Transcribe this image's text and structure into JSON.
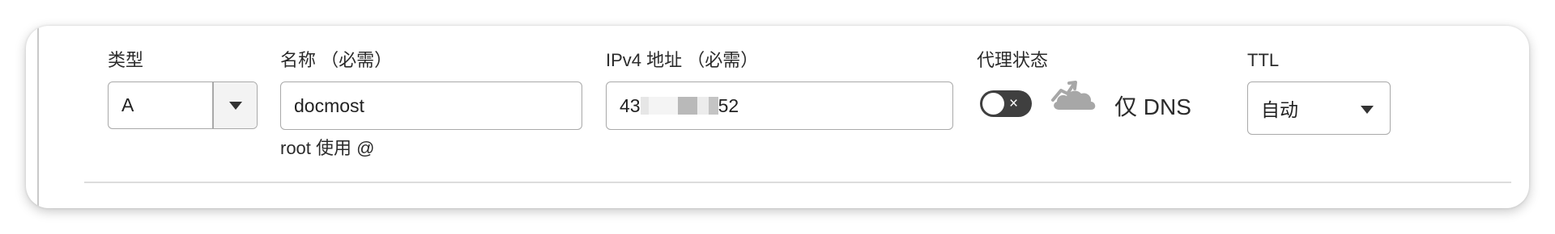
{
  "record": {
    "type_label": "类型",
    "type_value": "A",
    "name_label": "名称 （必需）",
    "name_value": "docmost",
    "name_hint": "root 使用 @",
    "ipv4_label": "IPv4 地址 （必需）",
    "ipv4_prefix": "43",
    "ipv4_suffix": "52",
    "proxy_label": "代理状态",
    "proxy_toggle_symbol": "×",
    "proxy_state_text": "仅 DNS",
    "ttl_label": "TTL",
    "ttl_value": "自动"
  },
  "icons": {
    "type_dropdown": "chevron-down-icon",
    "proxy_cloud": "cloud-icon",
    "ttl_dropdown": "chevron-down-icon"
  },
  "colors": {
    "toggle_off": "#3f3f3f",
    "cloud": "#a7a7a7",
    "border": "#a9a9a9"
  }
}
